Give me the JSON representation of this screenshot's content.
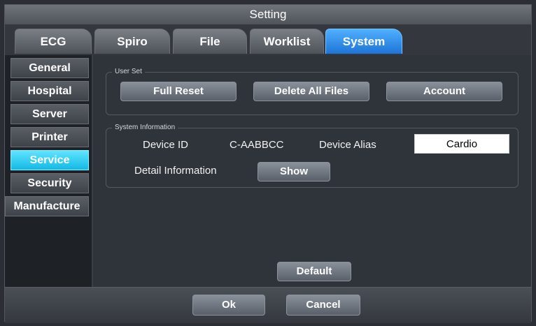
{
  "window": {
    "title": "Setting"
  },
  "tabs": [
    {
      "label": "ECG",
      "active": false
    },
    {
      "label": "Spiro",
      "active": false
    },
    {
      "label": "File",
      "active": false
    },
    {
      "label": "Worklist",
      "active": false
    },
    {
      "label": "System",
      "active": true
    }
  ],
  "sidebar": {
    "items": [
      {
        "label": "General",
        "active": false
      },
      {
        "label": "Hospital",
        "active": false
      },
      {
        "label": "Server",
        "active": false
      },
      {
        "label": "Printer",
        "active": false
      },
      {
        "label": "Service",
        "active": true
      },
      {
        "label": "Security",
        "active": false
      },
      {
        "label": "Manufacture",
        "active": false
      }
    ]
  },
  "user_set": {
    "legend": "User Set",
    "full_reset_label": "Full Reset",
    "delete_all_label": "Delete All Files",
    "account_label": "Account"
  },
  "system_info": {
    "legend": "System Information",
    "device_id_label": "Device ID",
    "device_id_value": "C-AABBCC",
    "device_alias_label": "Device Alias",
    "device_alias_value": "Cardio",
    "detail_label": "Detail Information",
    "show_label": "Show"
  },
  "content": {
    "default_label": "Default"
  },
  "footer": {
    "ok_label": "Ok",
    "cancel_label": "Cancel"
  },
  "colors": {
    "accent_tab": "#1e74d6",
    "accent_nav": "#13b9e6"
  }
}
